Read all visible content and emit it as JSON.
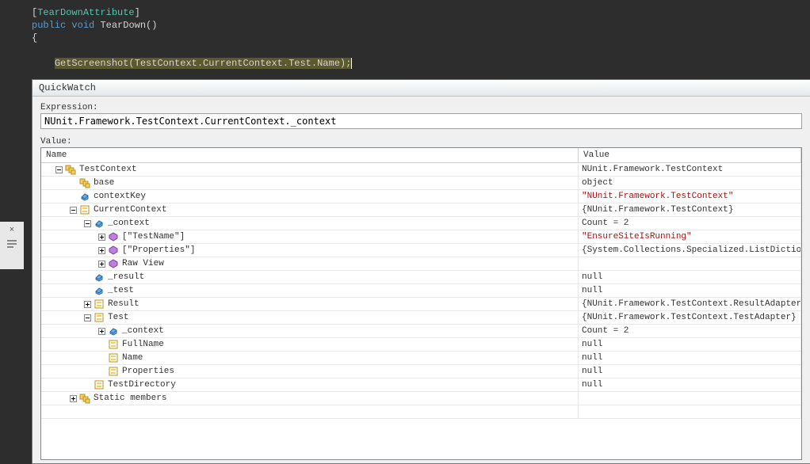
{
  "code": {
    "line1_open": "[",
    "line1_attr": "TearDownAttribute",
    "line1_close": "]",
    "line2_kw1": "public",
    "line2_kw2": "void",
    "line2_method": "TearDown()",
    "line3": "{",
    "line5_hl1": "GetScreenshot(",
    "line5_hl2": "TestContext",
    "line5_hl3": ".CurrentContext.Test.Name)",
    "line5_semi": ";"
  },
  "qw": {
    "title": "QuickWatch",
    "expr_label": "Expression:",
    "expr_value": "NUnit.Framework.TestContext.CurrentContext._context",
    "value_label": "Value:",
    "col_name": "Name",
    "col_value": "Value"
  },
  "rows": [
    {
      "depth": 0,
      "exp": "minus",
      "icon": "class",
      "name": "TestContext",
      "value": "NUnit.Framework.TestContext",
      "vtype": "plain"
    },
    {
      "depth": 1,
      "exp": "none",
      "icon": "class",
      "name": "base",
      "value": "object",
      "vtype": "plain"
    },
    {
      "depth": 1,
      "exp": "none",
      "icon": "field",
      "name": "contextKey",
      "value": "\"NUnit.Framework.TestContext\"",
      "vtype": "str"
    },
    {
      "depth": 1,
      "exp": "minus",
      "icon": "prop",
      "name": "CurrentContext",
      "value": "{NUnit.Framework.TestContext}",
      "vtype": "plain"
    },
    {
      "depth": 2,
      "exp": "minus",
      "icon": "field",
      "name": "_context",
      "value": "Count = 2",
      "vtype": "plain"
    },
    {
      "depth": 3,
      "exp": "plus",
      "icon": "method",
      "name": "[\"TestName\"]",
      "value": "\"EnsureSiteIsRunning\"",
      "vtype": "str"
    },
    {
      "depth": 3,
      "exp": "plus",
      "icon": "method",
      "name": "[\"Properties\"]",
      "value": "{System.Collections.Specialized.ListDictionary}",
      "vtype": "plain"
    },
    {
      "depth": 3,
      "exp": "plus",
      "icon": "method",
      "name": "Raw View",
      "value": "",
      "vtype": "plain"
    },
    {
      "depth": 2,
      "exp": "none",
      "icon": "field",
      "name": "_result",
      "value": "null",
      "vtype": "plain"
    },
    {
      "depth": 2,
      "exp": "none",
      "icon": "field",
      "name": "_test",
      "value": "null",
      "vtype": "plain"
    },
    {
      "depth": 2,
      "exp": "plus",
      "icon": "prop",
      "name": "Result",
      "value": "{NUnit.Framework.TestContext.ResultAdapter}",
      "vtype": "plain"
    },
    {
      "depth": 2,
      "exp": "minus",
      "icon": "prop",
      "name": "Test",
      "value": "{NUnit.Framework.TestContext.TestAdapter}",
      "vtype": "plain"
    },
    {
      "depth": 3,
      "exp": "plus",
      "icon": "field",
      "name": "_context",
      "value": "Count = 2",
      "vtype": "plain"
    },
    {
      "depth": 3,
      "exp": "none",
      "icon": "prop",
      "name": "FullName",
      "value": "null",
      "vtype": "plain"
    },
    {
      "depth": 3,
      "exp": "none",
      "icon": "prop",
      "name": "Name",
      "value": "null",
      "vtype": "plain"
    },
    {
      "depth": 3,
      "exp": "none",
      "icon": "prop",
      "name": "Properties",
      "value": "null",
      "vtype": "plain"
    },
    {
      "depth": 2,
      "exp": "none",
      "icon": "prop",
      "name": "TestDirectory",
      "value": "null",
      "vtype": "plain"
    },
    {
      "depth": 1,
      "exp": "plus",
      "icon": "class",
      "name": "Static members",
      "value": "",
      "vtype": "plain"
    }
  ]
}
